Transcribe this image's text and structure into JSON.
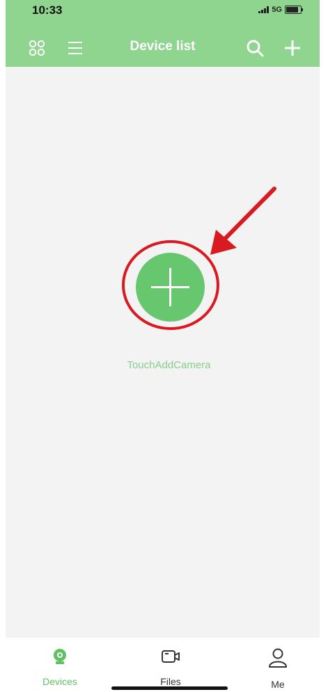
{
  "status_bar": {
    "time": "10:33",
    "network": "5G"
  },
  "header": {
    "title": "Device list"
  },
  "main": {
    "add_camera_label": "TouchAddCamera"
  },
  "tabs": [
    {
      "label": "Devices",
      "icon": "camera-icon",
      "active": true
    },
    {
      "label": "Files",
      "icon": "files-icon",
      "active": false
    },
    {
      "label": "Me",
      "icon": "person-icon",
      "active": false
    }
  ],
  "colors": {
    "header": "#8fd48f",
    "accent": "#67c76f",
    "highlight": "#d91a20",
    "background": "#f3f3f3"
  }
}
